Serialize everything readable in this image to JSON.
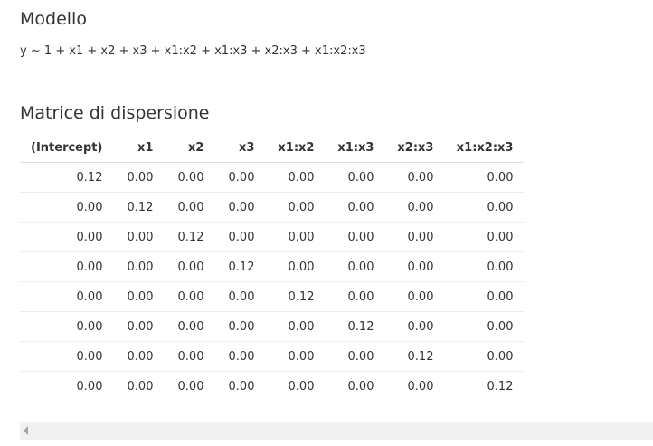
{
  "model": {
    "title": "Modello",
    "formula": "y ~ 1 + x1 + x2 + x3 + x1:x2 + x1:x3 + x2:x3 + x1:x2:x3"
  },
  "dispersion": {
    "title": "Matrice di dispersione",
    "headers": [
      "(Intercept)",
      "x1",
      "x2",
      "x3",
      "x1:x2",
      "x1:x3",
      "x2:x3",
      "x1:x2:x3"
    ],
    "rows": [
      [
        "0.12",
        "0.00",
        "0.00",
        "0.00",
        "0.00",
        "0.00",
        "0.00",
        "0.00"
      ],
      [
        "0.00",
        "0.12",
        "0.00",
        "0.00",
        "0.00",
        "0.00",
        "0.00",
        "0.00"
      ],
      [
        "0.00",
        "0.00",
        "0.12",
        "0.00",
        "0.00",
        "0.00",
        "0.00",
        "0.00"
      ],
      [
        "0.00",
        "0.00",
        "0.00",
        "0.12",
        "0.00",
        "0.00",
        "0.00",
        "0.00"
      ],
      [
        "0.00",
        "0.00",
        "0.00",
        "0.00",
        "0.12",
        "0.00",
        "0.00",
        "0.00"
      ],
      [
        "0.00",
        "0.00",
        "0.00",
        "0.00",
        "0.00",
        "0.12",
        "0.00",
        "0.00"
      ],
      [
        "0.00",
        "0.00",
        "0.00",
        "0.00",
        "0.00",
        "0.00",
        "0.12",
        "0.00"
      ],
      [
        "0.00",
        "0.00",
        "0.00",
        "0.00",
        "0.00",
        "0.00",
        "0.00",
        "0.12"
      ]
    ]
  },
  "scrollbar": {
    "left_arrow_icon": "triangle-left-icon"
  }
}
